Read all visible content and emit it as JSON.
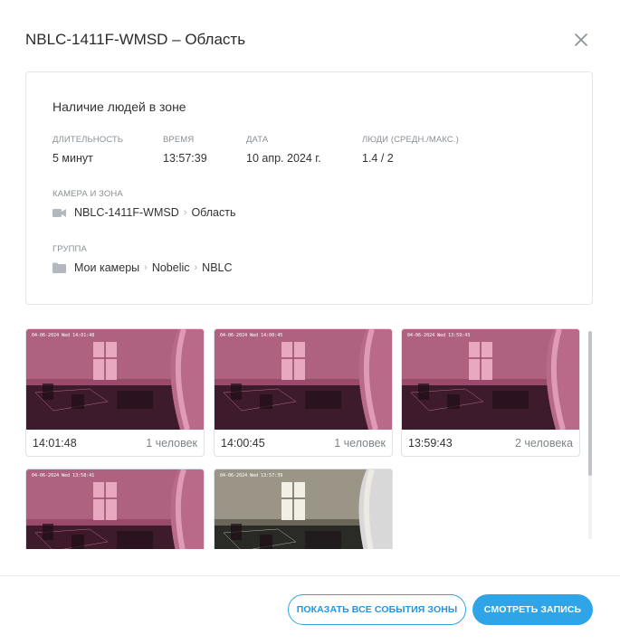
{
  "dialog": {
    "title": "NBLC-1411F-WMSD – Область",
    "close_icon": "close-icon"
  },
  "event": {
    "title": "Наличие людей в зоне",
    "fields": {
      "duration_label": "ДЛИТЕЛЬНОСТЬ",
      "duration_value": "5 минут",
      "time_label": "ВРЕМЯ",
      "time_value": "13:57:39",
      "date_label": "ДАТА",
      "date_value": "10 апр. 2024 г.",
      "people_label": "ЛЮДИ (СРЕДН./МАКС.)",
      "people_value": "1.4 / 2"
    },
    "camera_zone": {
      "label": "КАМЕРА И ЗОНА",
      "icon": "video-camera-icon",
      "camera": "NBLC-1411F-WMSD",
      "zone": "Область"
    },
    "group": {
      "label": "ГРУППА",
      "icon": "folder-icon",
      "path": [
        "Мои камеры",
        "Nobelic",
        "NBLC"
      ]
    }
  },
  "thumbnails": [
    {
      "time": "14:01:48",
      "count": "1 человек",
      "stamp": "04-06-2024 Wed 14:01:48",
      "tint": "pink"
    },
    {
      "time": "14:00:45",
      "count": "1 человек",
      "stamp": "04-06-2024 Wed 14:00:45",
      "tint": "pink"
    },
    {
      "time": "13:59:43",
      "count": "2 человека",
      "stamp": "04-06-2024 Wed 13:59:43",
      "tint": "pink"
    },
    {
      "time": "",
      "count": "",
      "stamp": "04-06-2024 Wed 13:58:41",
      "tint": "pink"
    },
    {
      "time": "",
      "count": "",
      "stamp": "04-06-2024 Wed 13:57:39",
      "tint": "natural"
    }
  ],
  "buttons": {
    "show_all": "ПОКАЗАТЬ ВСЕ СОБЫТИЯ ЗОНЫ",
    "watch": "СМОТРЕТЬ ЗАПИСЬ"
  },
  "colors": {
    "accent": "#2fa4e7",
    "pink_tint": "#8b3a5a",
    "natural_tint": "#5a5a4e"
  }
}
